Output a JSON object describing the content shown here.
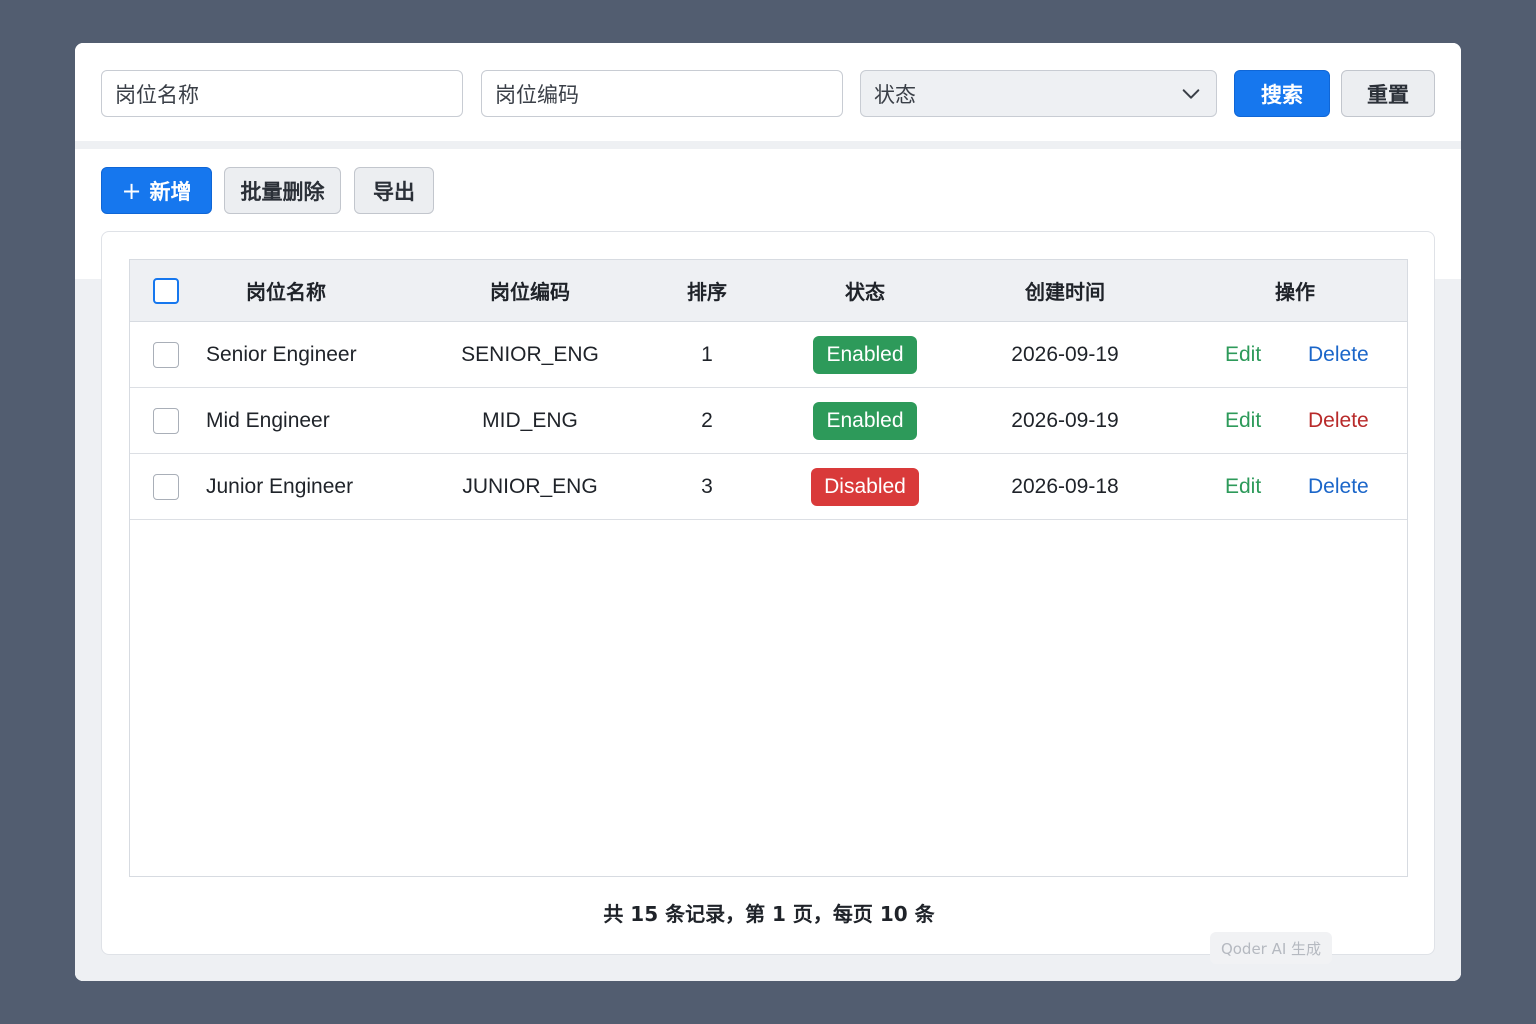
{
  "filters": {
    "name_placeholder": "岗位名称",
    "code_placeholder": "岗位编码",
    "status_placeholder": "状态",
    "search_label": "搜索",
    "reset_label": "重置"
  },
  "toolbar": {
    "add_label": "新增",
    "batch_delete_label": "批量删除",
    "export_label": "导出"
  },
  "table": {
    "columns": [
      "岗位名称",
      "岗位编码",
      "排序",
      "状态",
      "创建时间",
      "操作"
    ],
    "rows": [
      {
        "name": "Senior Engineer",
        "code": "SENIOR_ENG",
        "sort": "1",
        "status": "Enabled",
        "created": "2026-09-19",
        "edit": "Edit",
        "delete": "Delete"
      },
      {
        "name": "Mid Engineer",
        "code": "MID_ENG",
        "sort": "2",
        "status": "Enabled",
        "created": "2026-09-19",
        "edit": "Edit",
        "delete": "Delete"
      },
      {
        "name": "Junior Engineer",
        "code": "JUNIOR_ENG",
        "sort": "3",
        "status": "Disabled",
        "created": "2026-09-18",
        "edit": "Edit",
        "delete": "Delete"
      }
    ]
  },
  "pagination": {
    "summary": "共 15 条记录，第 1 页，每页 10 条"
  },
  "watermark": "Qoder AI 生成",
  "colors": {
    "primary": "#1677ee",
    "enabled": "#2d9a5a",
    "disabled": "#d93a3a",
    "delete_link": "#1b66c9",
    "delete_link_alt": "#b82a2a"
  }
}
